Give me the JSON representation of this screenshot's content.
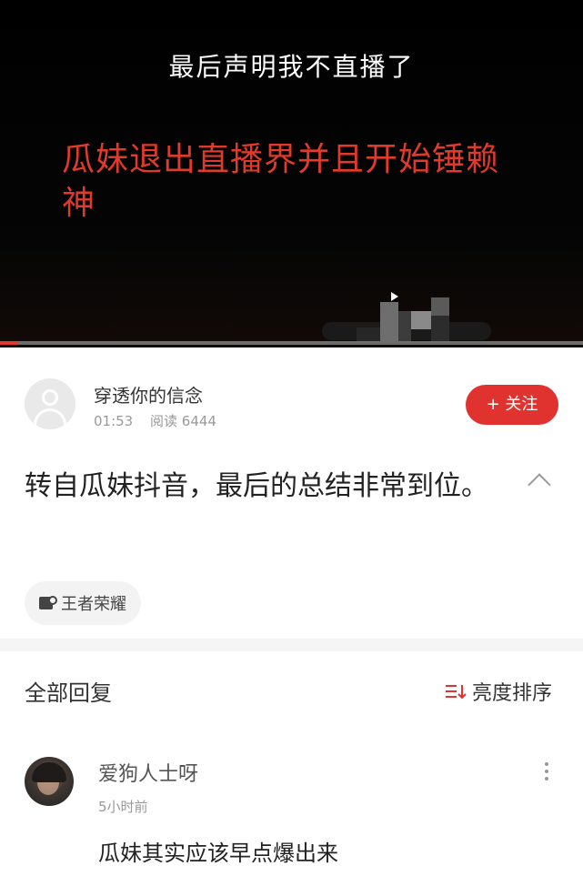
{
  "video": {
    "caption_top": "最后声明我不直播了",
    "caption_red": "瓜妹退出直播界并且开始锤赖神",
    "progress_fraction": 0.03,
    "colors": {
      "background": "#000000",
      "caption_red": "#e03a2c",
      "progress": "#e03a2c"
    }
  },
  "author": {
    "name": "穿透你的信念",
    "time": "01:53",
    "reads": "阅读 6444",
    "follow_label": "+ 关注",
    "avatar_icon": "default-user-icon"
  },
  "post": {
    "text": "转自瓜妹抖音，最后的总结非常到位。",
    "collapse_icon": "chevron-up-icon",
    "tag": {
      "label": "王者荣耀",
      "icon": "game-tag-icon"
    }
  },
  "replies": {
    "title": "全部回复",
    "sort_label": "亮度排序",
    "sort_icon": "sort-icon"
  },
  "comments": [
    {
      "name": "爱狗人士呀",
      "time": "5小时前",
      "text": "瓜妹其实应该早点爆出来",
      "more_icon": "more-vertical-icon"
    }
  ],
  "colors": {
    "accent": "#e0322f",
    "muted": "#999999",
    "divider": "#f5f5f5"
  }
}
